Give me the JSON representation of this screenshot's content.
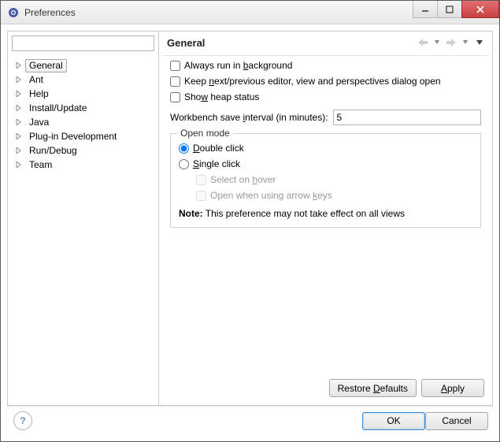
{
  "window": {
    "title": "Preferences"
  },
  "sidebar": {
    "search_placeholder": "",
    "items": [
      {
        "label": "General"
      },
      {
        "label": "Ant"
      },
      {
        "label": "Help"
      },
      {
        "label": "Install/Update"
      },
      {
        "label": "Java"
      },
      {
        "label": "Plug-in Development"
      },
      {
        "label": "Run/Debug"
      },
      {
        "label": "Team"
      }
    ]
  },
  "content": {
    "title": "General",
    "checks": {
      "run_bg_pre": "Always run in ",
      "run_bg_u": "b",
      "run_bg_post": "ackground",
      "keep_pre": "Keep ",
      "keep_u": "n",
      "keep_post": "ext/previous editor, view and perspectives dialog open",
      "heap_pre": "Sho",
      "heap_u": "w",
      "heap_post": " heap status"
    },
    "interval_label_pre": "Workbench save ",
    "interval_label_u": "i",
    "interval_label_post": "nterval (in minutes):",
    "interval_value": "5",
    "openmode": {
      "legend": "Open mode",
      "double_pre": "",
      "double_u": "D",
      "double_post": "ouble click",
      "single_pre": "",
      "single_u": "S",
      "single_post": "ingle click",
      "hover_pre": "Select on ",
      "hover_u": "h",
      "hover_post": "over",
      "arrow_pre": "Open when using arrow ",
      "arrow_u": "k",
      "arrow_post": "eys",
      "note_bold": "Note:",
      "note_text": " This preference may not take effect on all views"
    },
    "buttons": {
      "restore_pre": "Restore ",
      "restore_u": "D",
      "restore_post": "efaults",
      "apply_pre": "",
      "apply_u": "A",
      "apply_post": "pply"
    }
  },
  "footer": {
    "ok": "OK",
    "cancel": "Cancel"
  }
}
